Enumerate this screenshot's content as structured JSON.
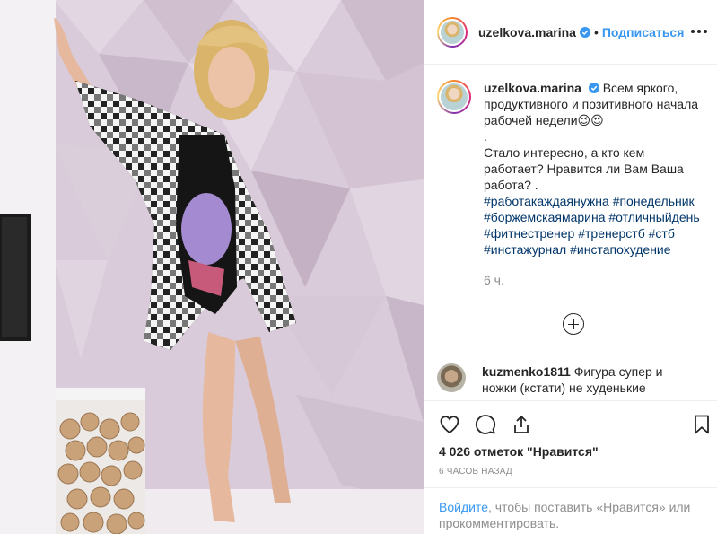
{
  "post": {
    "author": "uzelkova.marina",
    "follow_label": "Подписаться",
    "dot": "•"
  },
  "caption": {
    "username": "uzelkova.marina",
    "line1": "Всем яркого, продуктивного и позитивного начала рабочей недели😉😍",
    "line2": ".",
    "line3": "Стало интересно, а кто кем работает? Нравится ли Вам Ваша работа? .",
    "hashtags": [
      "#работакаждаянужна",
      "#понедельник",
      "#боржемскаямарина",
      "#отличныйдень",
      "#фитнестренер",
      "#тренерстб",
      "#стб",
      "#инстажурнал",
      "#инстапохудение"
    ],
    "time": "6 ч."
  },
  "comment": {
    "username": "kuzmenko1811",
    "text": "Фигура супер и ножки (кстати) не худенькие"
  },
  "stats": {
    "likes": "4 026 отметок \"Нравится\"",
    "time": "6 часов назад"
  },
  "login": {
    "link": "Войдите",
    "text": ", чтобы поставить «Нравится» или прокомментировать."
  },
  "colors": {
    "link_blue": "#3897f0",
    "hashtag": "#003569",
    "muted": "#8e8e8e"
  },
  "icons": [
    "verified-badge-icon",
    "more-options-icon",
    "load-more-comments-icon",
    "heart-icon",
    "comment-icon",
    "share-icon",
    "bookmark-icon"
  ]
}
